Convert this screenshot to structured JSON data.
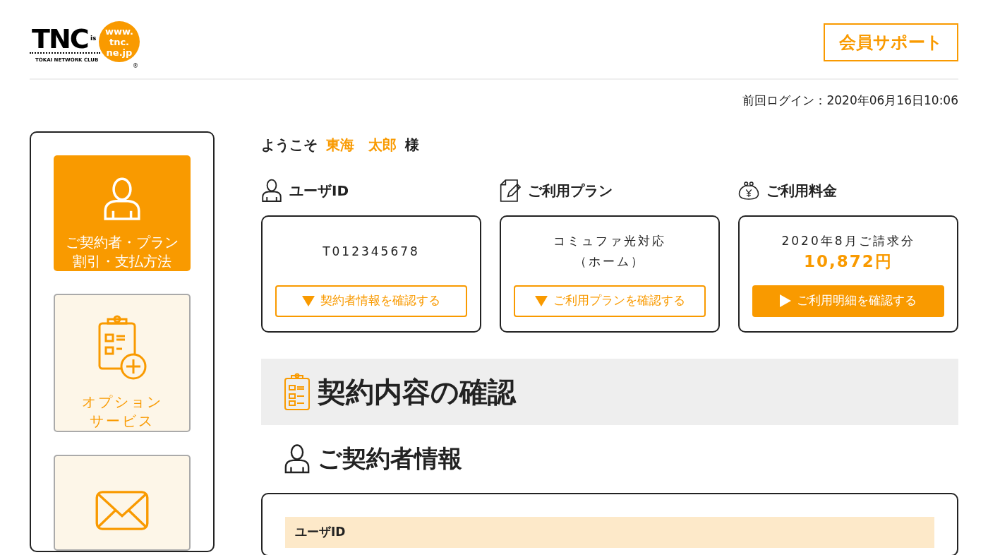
{
  "header": {
    "logo": {
      "mark": "TNC",
      "suffix": "is",
      "url_lines": [
        "www.",
        "tnc.",
        "ne.jp"
      ],
      "tagline": "TOKAI NETWORK CLUB",
      "registered": "®"
    },
    "support_button": "会員サポート"
  },
  "last_login": "前回ログイン：2020年06月16日10:06",
  "sidebar": {
    "items": [
      {
        "kind": "person",
        "label_lines": [
          "ご契約者・プラン",
          "割引・支払方法"
        ],
        "selected": true
      },
      {
        "kind": "clipboard-plus",
        "label_lines": [
          "オプション",
          "サービス"
        ],
        "selected": false
      },
      {
        "kind": "envelope",
        "selected": false
      }
    ]
  },
  "welcome": {
    "prefix": "ようこそ",
    "name": "東海　太郎",
    "suffix": "様"
  },
  "summary_cards": [
    {
      "kind": "person",
      "title": "ユーザID",
      "lines": [
        "T012345678"
      ],
      "button": {
        "kind": "outline",
        "label": "契約者情報を確認する"
      }
    },
    {
      "kind": "document-pen",
      "title": "ご利用プラン",
      "lines": [
        "コミュファ光対応",
        "（ホーム）"
      ],
      "button": {
        "kind": "outline",
        "label": "ご利用プランを確認する"
      }
    },
    {
      "kind": "purse",
      "title": "ご利用料金",
      "lines": [
        "2020年8月ご請求分"
      ],
      "amount": "10,872円",
      "button": {
        "kind": "filled",
        "label": "ご利用明細を確認する"
      }
    }
  ],
  "section": {
    "title": "契約内容の確認",
    "subsection": {
      "title": "ご契約者情報",
      "table": {
        "header": "ユーザID"
      }
    }
  }
}
